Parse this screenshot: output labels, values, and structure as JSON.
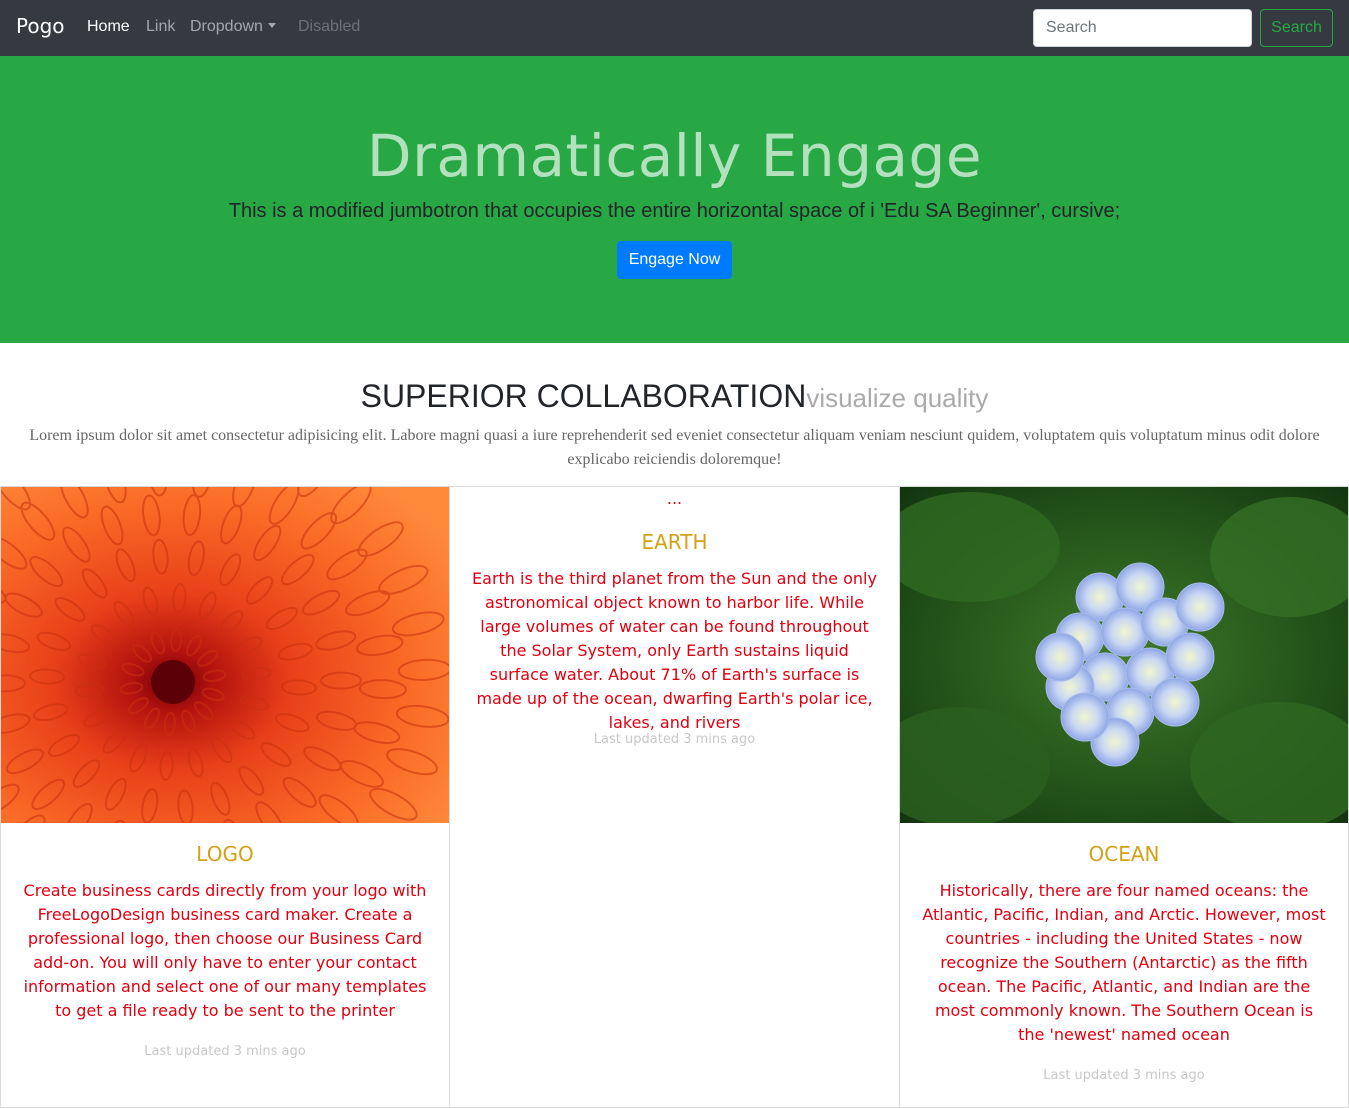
{
  "navbar": {
    "brand": "Pogo",
    "links": [
      "Home",
      "Link",
      "Dropdown",
      "Disabled"
    ],
    "search_placeholder": "Search",
    "search_button": "Search"
  },
  "jumbotron": {
    "title": "Dramatically Engage",
    "lead": "This is a modified jumbotron that occupies the entire horizontal space of i 'Edu SA Beginner', cursive;",
    "button": "Engage Now"
  },
  "section": {
    "title": "SUPERIOR COLLABORATION",
    "subtitle": "visualize quality",
    "text": "Lorem ipsum dolor sit amet consectetur adipisicing elit. Labore magni quasi a iure reprehenderit sed eveniet consectetur aliquam veniam nesciunt quidem, voluptatem quis voluptatum minus odit dolore explicabo reiciendis doloremque!"
  },
  "cards": [
    {
      "image": "orange-flower-image",
      "title": "LOGO",
      "text": "Create business cards directly from your logo with FreeLogoDesign business card maker. Create a professional logo, then choose our Business Card add-on. You will only have to enter your contact information and select one of our many templates to get a file ready to be sent to the printer",
      "meta": "Last updated 3 mins ago"
    },
    {
      "ellipsis": "...",
      "title": "EARTH",
      "text": "Earth is the third planet from the Sun and the only astronomical object known to harbor life. While large volumes of water can be found throughout the Solar System, only Earth sustains liquid surface water. About 71% of Earth's surface is made up of the ocean, dwarfing Earth's polar ice, lakes, and rivers",
      "meta": "Last updated 3 mins ago"
    },
    {
      "image": "hydrangea-image",
      "title": "OCEAN",
      "text": "Historically, there are four named oceans: the Atlantic, Pacific, Indian, and Arctic. However, most countries - including the United States - now recognize the Southern (Antarctic) as the fifth ocean. The Pacific, Atlantic, and Indian are the most commonly known. The Southern Ocean is the 'newest' named ocean",
      "meta": "Last updated 3 mins ago"
    }
  ],
  "colors": {
    "navbar_bg": "#343a40",
    "jumbotron_bg": "#28a745",
    "primary_button": "#007bff",
    "card_title": "#d4a017",
    "card_text": "#e0000f"
  }
}
